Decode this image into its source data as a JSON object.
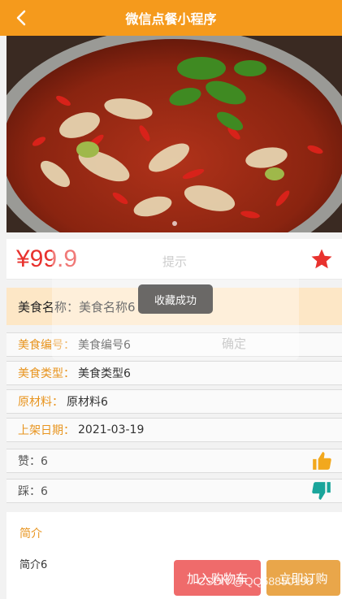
{
  "header": {
    "title": "微信点餐小程序",
    "back_icon": "chevron-left-icon"
  },
  "product": {
    "price": "¥99.9",
    "name_label": "美食名称：",
    "name_value": "美食名称6",
    "favorite_icon": "star-icon",
    "favorite_color": "#e8322e"
  },
  "info": [
    {
      "label": "美食编号：",
      "value": "美食编号6"
    },
    {
      "label": "美食类型：",
      "value": "美食类型6"
    },
    {
      "label": "原材料：",
      "value": "原材料6"
    },
    {
      "label": "上架日期：",
      "value": "2021-03-19"
    }
  ],
  "likes": {
    "label": "赞：6",
    "icon": "thumbs-up-icon"
  },
  "dislikes": {
    "label": "踩：6",
    "icon": "thumbs-down-icon"
  },
  "intro": {
    "title": "简介",
    "text": "简介6"
  },
  "actions": {
    "cart_label": "加入购物车",
    "buy_label": "立即订购"
  },
  "dialog": {
    "title": "提示",
    "confirm": "确定"
  },
  "toast": {
    "message": "收藏成功"
  },
  "watermark": "CSDN @QQ58850198",
  "colors": {
    "accent": "#f59a1c",
    "price": "#e8322e",
    "label": "#e8941e",
    "cart": "#ef6b6b",
    "buy": "#e9a64a"
  }
}
